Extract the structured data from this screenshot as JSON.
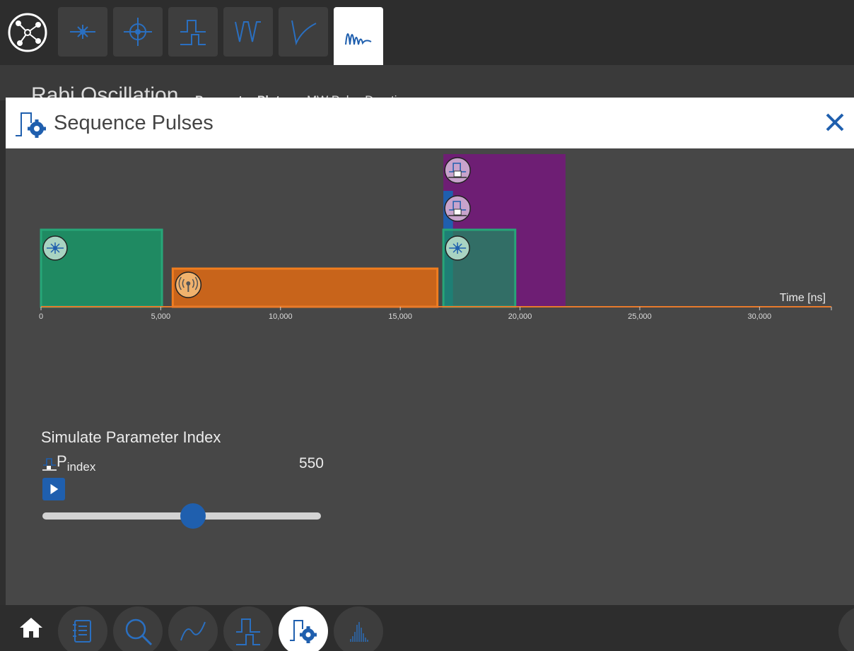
{
  "toolbar": {
    "tabs": [
      {
        "name": "laser-tab",
        "icon": "laser-icon"
      },
      {
        "name": "crosshair-tab",
        "icon": "crosshair-icon"
      },
      {
        "name": "pulse-tab",
        "icon": "pulse-icon"
      },
      {
        "name": "odmr-tab",
        "icon": "odmr-dip-icon"
      },
      {
        "name": "decay-tab",
        "icon": "decay-icon"
      },
      {
        "name": "rabi-tab",
        "icon": "oscillation-icon",
        "active": true
      }
    ]
  },
  "background_page": {
    "title": "Rabi Oscillation",
    "subtitle_bold": "Parameter Plot",
    "subtitle": "MW Pulse Duration"
  },
  "dialog": {
    "title": "Sequence Pulses",
    "close_icon": "close-icon"
  },
  "chart_data": {
    "type": "timeline",
    "xlabel": "Time [ns]",
    "xlim": [
      0,
      33000
    ],
    "ticks": [
      0,
      5000,
      10000,
      15000,
      20000,
      25000,
      30000
    ],
    "tick_labels": [
      "0",
      "5,000",
      "10,000",
      "15,000",
      "20,000",
      "25,000",
      "30,000"
    ],
    "pulses": [
      {
        "channel": "laser",
        "start": 0,
        "end": 5050,
        "level": 1,
        "color": "#1f8a62",
        "icon": "laser-icon"
      },
      {
        "channel": "microwave",
        "start": 5500,
        "end": 16550,
        "level": 0,
        "color": "#c8641b",
        "icon": "microwave-icon"
      },
      {
        "channel": "laser",
        "start": 16800,
        "end": 19800,
        "level": 1,
        "color": "#1f8a62",
        "icon": "laser-icon"
      },
      {
        "channel": "counter",
        "start": 16800,
        "end": 17200,
        "level": 2,
        "color": "#1f5fae",
        "icon": "counter-icon"
      },
      {
        "channel": "gate",
        "start": 16800,
        "end": 21900,
        "level": 3,
        "color": "#6e1e74",
        "icon": "counter-icon"
      }
    ]
  },
  "simulate": {
    "title": "Simulate Parameter Index",
    "param_symbol": "P",
    "param_sub": "index",
    "value": "550",
    "slider_fraction": 0.54,
    "play_icon": "play-icon"
  },
  "bottom_nav": {
    "items": [
      {
        "name": "home-button",
        "icon": "home-icon"
      },
      {
        "name": "notebook-button",
        "icon": "notebook-icon"
      },
      {
        "name": "search-button",
        "icon": "search-icon"
      },
      {
        "name": "signal-button",
        "icon": "waveform-icon"
      },
      {
        "name": "pulse-button",
        "icon": "pulse-icon"
      },
      {
        "name": "sequence-button",
        "icon": "sequence-gear-icon",
        "active": true
      },
      {
        "name": "histogram-button",
        "icon": "histogram-icon"
      }
    ]
  },
  "colors": {
    "accent": "#1f5fae",
    "laser": "#1f8a62",
    "microwave": "#c8641b",
    "gate": "#6e1e74",
    "axis": "#e87a2c"
  }
}
